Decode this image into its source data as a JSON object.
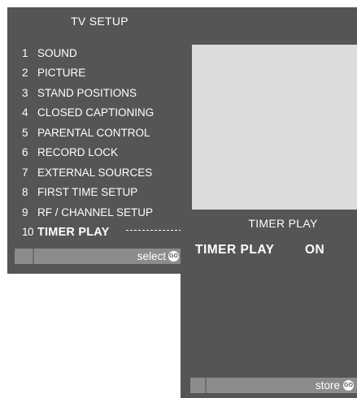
{
  "main_menu": {
    "title": "TV  SETUP",
    "items": [
      {
        "number": "1",
        "label": "SOUND"
      },
      {
        "number": "2",
        "label": "PICTURE"
      },
      {
        "number": "3",
        "label": "STAND POSITIONS"
      },
      {
        "number": "4",
        "label": "CLOSED CAPTIONING"
      },
      {
        "number": "5",
        "label": "PARENTAL CONTROL"
      },
      {
        "number": "6",
        "label": "RECORD LOCK"
      },
      {
        "number": "7",
        "label": "EXTERNAL SOURCES"
      },
      {
        "number": "8",
        "label": "FIRST TIME SETUP"
      },
      {
        "number": "9",
        "label": "RF / CHANNEL SETUP"
      },
      {
        "number": "10",
        "label": "TIMER PLAY"
      }
    ],
    "selected_index": 9,
    "footer": {
      "label": "select",
      "go_label": "GO"
    }
  },
  "timer_play_menu": {
    "title": "TIMER  PLAY",
    "setting": {
      "label": "TIMER  PLAY",
      "value": "ON"
    },
    "footer": {
      "label": "store",
      "go_label": "GO"
    }
  },
  "colors": {
    "panel_background": "#555555",
    "footer_bar": "#8c8c8c",
    "preview_area": "#dcdcdc",
    "text": "#ffffff"
  }
}
